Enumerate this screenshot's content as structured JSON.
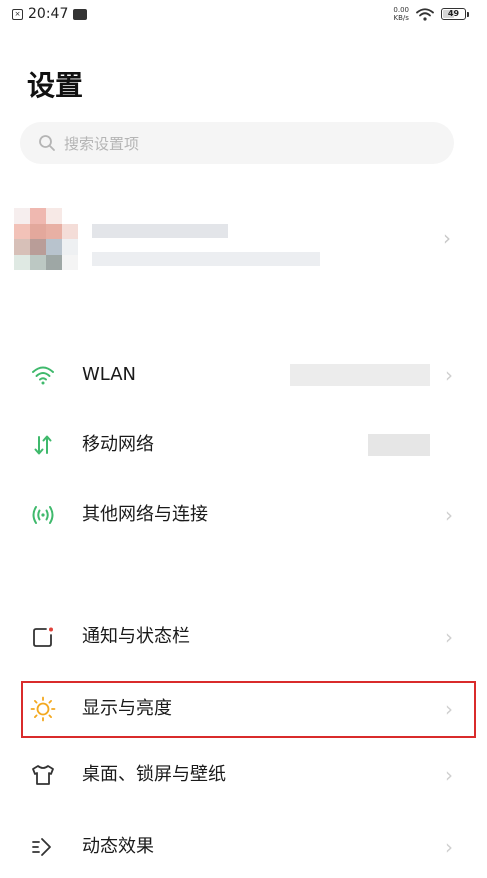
{
  "status_bar": {
    "time": "20:47",
    "net_speed_value": "0.00",
    "net_speed_unit": "KB/s",
    "battery": "49"
  },
  "page_title": "设置",
  "search": {
    "placeholder": "搜索设置项"
  },
  "sections": {
    "network": [
      {
        "label": "WLAN",
        "icon": "wifi-icon"
      },
      {
        "label": "移动网络",
        "icon": "mobile-data-icon"
      },
      {
        "label": "其他网络与连接",
        "icon": "network-connections-icon"
      }
    ],
    "display": [
      {
        "label": "通知与状态栏",
        "icon": "notification-icon"
      },
      {
        "label": "显示与亮度",
        "icon": "brightness-icon"
      },
      {
        "label": "桌面、锁屏与壁纸",
        "icon": "wallpaper-icon"
      },
      {
        "label": "动态效果",
        "icon": "motion-effects-icon"
      }
    ]
  },
  "colors": {
    "accent_green": "#3fb96c",
    "brightness_yellow": "#f3a81e",
    "highlight_red": "#d92b2b",
    "chevron_gray": "#cfcfcf"
  }
}
